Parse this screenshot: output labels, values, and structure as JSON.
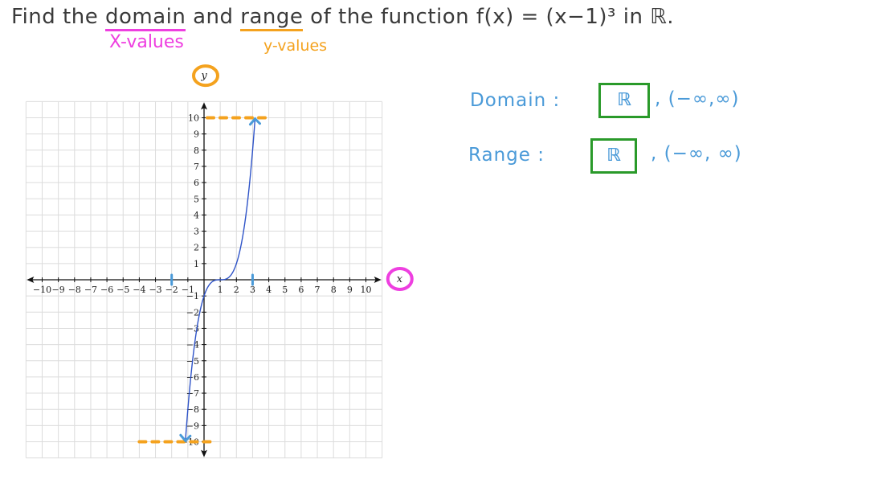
{
  "title": {
    "prefix": "Find the ",
    "domain_word": "domain",
    "middle": " and ",
    "range_word": "range",
    "suffix": " of the function f(x) = (x−1)³ in ℝ."
  },
  "annotations": {
    "domain_note": "X-values",
    "range_note": "y-values",
    "domain_answer_label": "Domain :",
    "domain_answer_set": "ℝ",
    "domain_answer_interval": ", (−∞,∞)",
    "range_answer_label": "Range :",
    "range_answer_set": "ℝ",
    "range_answer_interval": ", (−∞, ∞)"
  },
  "colors": {
    "text": "#3a3a3a",
    "pink": "#ee3fe0",
    "orange": "#f4a21e",
    "blue_ink": "#4a9ad8",
    "green_box": "#2a9a2a",
    "curve": "#2f54c8",
    "grid": "#dcdcdc"
  },
  "chart_data": {
    "type": "line",
    "title": "",
    "xlabel": "x",
    "ylabel": "y",
    "xlim": [
      -11,
      11
    ],
    "ylim": [
      -11,
      11
    ],
    "grid": true,
    "x_ticks": [
      -10,
      -9,
      -8,
      -7,
      -6,
      -5,
      -4,
      -3,
      -2,
      -1,
      1,
      2,
      3,
      4,
      5,
      6,
      7,
      8,
      9,
      10
    ],
    "y_ticks": [
      -10,
      -9,
      -8,
      -7,
      -6,
      -5,
      -4,
      -3,
      -2,
      -1,
      1,
      2,
      3,
      4,
      5,
      6,
      7,
      8,
      9,
      10
    ],
    "x_tick_labels": [
      "−10",
      "−9",
      "−8",
      "−7",
      "−6",
      "−5",
      "−4",
      "−3",
      "−2",
      "−1",
      "1",
      "2",
      "3",
      "4",
      "5",
      "6",
      "7",
      "8",
      "9",
      "10"
    ],
    "y_tick_labels": [
      "−10",
      "−9",
      "−8",
      "−7",
      "−6",
      "−5",
      "−4",
      "−3",
      "−2",
      "−1",
      "1",
      "2",
      "3",
      "4",
      "5",
      "6",
      "7",
      "8",
      "9",
      "10"
    ],
    "series": [
      {
        "name": "f(x) = (x-1)^3",
        "function": "(x-1)^3",
        "x_range": [
          -1.15,
          3.15
        ],
        "sample_points": [
          [
            -1.15,
            -9.94
          ],
          [
            -1,
            -8
          ],
          [
            0,
            -1
          ],
          [
            1,
            0
          ],
          [
            2,
            1
          ],
          [
            3,
            8
          ],
          [
            3.15,
            9.94
          ]
        ]
      }
    ],
    "annotations": {
      "range_dashes_y": [
        10,
        -10
      ],
      "x_marks": [
        -2,
        3
      ]
    }
  }
}
